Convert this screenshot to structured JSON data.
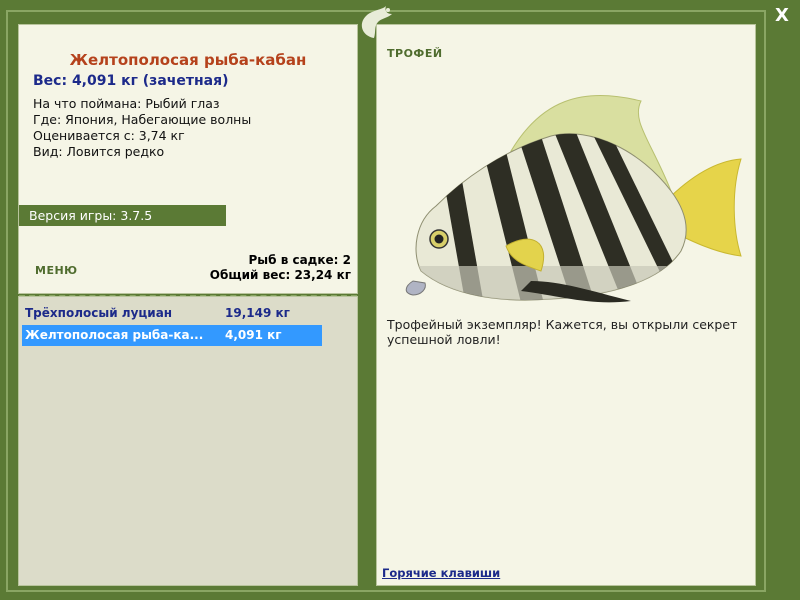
{
  "window": {
    "close_label": "X"
  },
  "fish": {
    "title": "Желтополосая рыба-кабан",
    "weight_line": "Вес: 4,091 кг (зачетная)",
    "caught_with": "На что поймана: Рыбий глаз",
    "location": "Где: Япония, Набегающие волны",
    "rated_from": "Оценивается с: 3,74 кг",
    "rarity": "Вид: Ловится редко"
  },
  "version": "Версия игры: 3.7.5",
  "menu_label": "МЕНЮ",
  "stats": {
    "fish_count": "Рыб в садке: 2",
    "total_weight": "Общий вес: 23,24 кг"
  },
  "keepnet": [
    {
      "name": "Трёхполосый луциан",
      "weight": "19,149 кг",
      "selected": false
    },
    {
      "name": "Желтополосая рыба-ка...",
      "weight": "4,091 кг",
      "selected": true
    }
  ],
  "right": {
    "badge": "ТРОФЕЙ",
    "description": "Трофейный экземпляр! Кажется, вы открыли секрет успешной ловли!",
    "hotkeys": "Горячие клавиши"
  },
  "colors": {
    "frame": "#5b7a35",
    "panel": "#f5f5e6",
    "list_bg": "#dcdcc9",
    "title_accent": "#b5421c",
    "text_blue": "#1c2a8a",
    "selection": "#3399ff"
  }
}
